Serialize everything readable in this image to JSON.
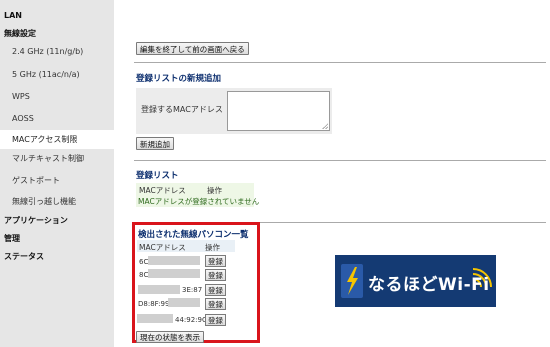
{
  "sidebar": {
    "items": [
      {
        "label": "LAN"
      },
      {
        "label": "無線設定"
      },
      {
        "label": "2.4 GHz (11n/g/b)"
      },
      {
        "label": "5 GHz (11ac/n/a)"
      },
      {
        "label": "WPS"
      },
      {
        "label": "AOSS"
      },
      {
        "label": "MACアクセス制限"
      },
      {
        "label": "マルチキャスト制御"
      },
      {
        "label": "ゲストポート"
      },
      {
        "label": "無線引っ越し機能"
      },
      {
        "label": "アプリケーション"
      },
      {
        "label": "管理"
      },
      {
        "label": "ステータス"
      }
    ]
  },
  "main": {
    "finish_button": "編集を終了して前の画面へ戻る",
    "new_entry": {
      "title": "登録リストの新規追加",
      "mac_label": "登録するMACアドレス",
      "add_button": "新規追加"
    },
    "registered": {
      "title": "登録リスト",
      "col_mac": "MACアドレス",
      "col_action": "操作",
      "empty_message": "MACアドレスが登録されていません"
    },
    "detected": {
      "title": "検出された無線パソコン一覧",
      "col_mac": "MACアドレス",
      "col_action": "操作",
      "rows": [
        {
          "mac": "6C",
          "button": "登録"
        },
        {
          "mac": "8C",
          "button": "登録"
        },
        {
          "mac": "3E:87",
          "button": "登録"
        },
        {
          "mac": "D8:8F:99",
          "button": "登録"
        },
        {
          "mac": "44:92:9C",
          "button": "登録"
        }
      ],
      "refresh_button": "現在の状態を表示"
    }
  },
  "logo": {
    "text": "なるほどWi-Fi",
    "bg_color": "#143a73",
    "accent_color": "#f5c400"
  },
  "colors": {
    "highlight_border": "#d9141b",
    "section_title": "#0c2e6e"
  }
}
